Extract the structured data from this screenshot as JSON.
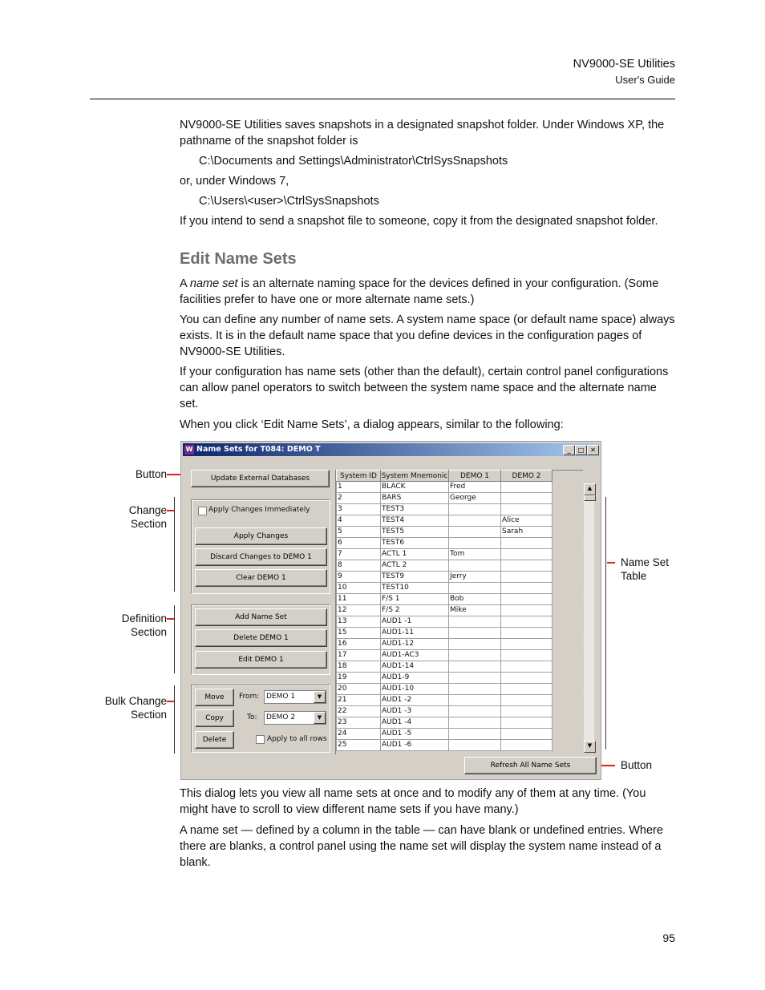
{
  "header": {
    "product": "NV9000-SE Utilities",
    "guide": "User's Guide"
  },
  "intro": {
    "p1": "NV9000-SE Utilities saves snapshots in a designated snapshot folder. Under Windows XP, the pathname of the snapshot folder is",
    "path_xp": "C:\\Documents and Settings\\Administrator\\CtrlSysSnapshots",
    "p2": "or, under Windows 7,",
    "path_w7": "C:\\Users\\<user>\\CtrlSysSnapshots",
    "p3": "If you intend to send a snapshot file to someone, copy it from the designated snapshot folder."
  },
  "section": {
    "title": "Edit Name Sets",
    "p1_a": "A ",
    "p1_em": "name set",
    "p1_b": " is an alternate naming space for the devices defined in your configuration. (Some facilities prefer to have one or more alternate name sets.)",
    "p2": "You can define any number of name sets. A system name space (or default name space) always exists. It is in the default name space that you define devices in the configuration pages of NV9000-SE Utilities.",
    "p3": "If your configuration has name sets (other than the default), certain control panel configurations can allow panel operators to switch between the system name space and the alternate name set.",
    "p4": "When you click ‘Edit Name Sets’, a dialog appears, similar to the following:",
    "p5": "This dialog lets you view all name sets at once and to modify any of them at any time. (You might have to scroll to view different name sets if you have many.)",
    "p6": "A name set — defined by a column in the table — can have blank or undefined entries. Where there are blanks, a control panel using the name set will display the system name instead of a blank."
  },
  "annotations": {
    "button_left": "Button",
    "change": "Change Section",
    "definition": "Definition Section",
    "bulk": "Bulk Change Section",
    "table": "Name Set Table",
    "button_right": "Button",
    "accent": "#e31b23"
  },
  "dialog": {
    "title": "Name Sets for T084: DEMO T",
    "update_btn": "Update External Databases",
    "apply_immediately": "Apply Changes Immediately",
    "apply_btn": "Apply Changes",
    "discard_btn": "Discard Changes to DEMO 1",
    "clear_btn": "Clear DEMO 1",
    "add_btn": "Add Name Set",
    "delete_set_btn": "Delete DEMO 1",
    "edit_btn": "Edit DEMO 1",
    "move_btn": "Move",
    "copy_btn": "Copy",
    "delete_btn": "Delete",
    "from_label": "From:",
    "from_value": "DEMO 1",
    "to_label": "To:",
    "to_value": "DEMO 2",
    "apply_all": "Apply to all rows",
    "refresh_btn": "Refresh All Name Sets",
    "columns": [
      "System ID",
      "System Mnemonic",
      "DEMO 1",
      "DEMO 2"
    ],
    "rows": [
      [
        "1",
        "BLACK",
        "Fred",
        ""
      ],
      [
        "2",
        "BARS",
        "George",
        ""
      ],
      [
        "3",
        "TEST3",
        "",
        ""
      ],
      [
        "4",
        "TEST4",
        "",
        "Alice"
      ],
      [
        "5",
        "TEST5",
        "",
        "Sarah"
      ],
      [
        "6",
        "TEST6",
        "",
        ""
      ],
      [
        "7",
        "ACTL 1",
        "Tom",
        ""
      ],
      [
        "8",
        "ACTL 2",
        "",
        ""
      ],
      [
        "9",
        "TEST9",
        "Jerry",
        ""
      ],
      [
        "10",
        "TEST10",
        "",
        ""
      ],
      [
        "11",
        "F/S 1",
        "Bob",
        ""
      ],
      [
        "12",
        "F/S 2",
        "Mike",
        ""
      ],
      [
        "13",
        "AUD1 -1",
        "",
        ""
      ],
      [
        "15",
        "AUD1-11",
        "",
        ""
      ],
      [
        "16",
        "AUD1-12",
        "",
        ""
      ],
      [
        "17",
        "AUD1-AC3",
        "",
        ""
      ],
      [
        "18",
        "AUD1-14",
        "",
        ""
      ],
      [
        "19",
        "AUD1-9",
        "",
        ""
      ],
      [
        "20",
        "AUD1-10",
        "",
        ""
      ],
      [
        "21",
        "AUD1 -2",
        "",
        ""
      ],
      [
        "22",
        "AUD1 -3",
        "",
        ""
      ],
      [
        "23",
        "AUD1 -4",
        "",
        ""
      ],
      [
        "24",
        "AUD1 -5",
        "",
        ""
      ],
      [
        "25",
        "AUD1 -6",
        "",
        ""
      ]
    ]
  },
  "page_number": "95"
}
